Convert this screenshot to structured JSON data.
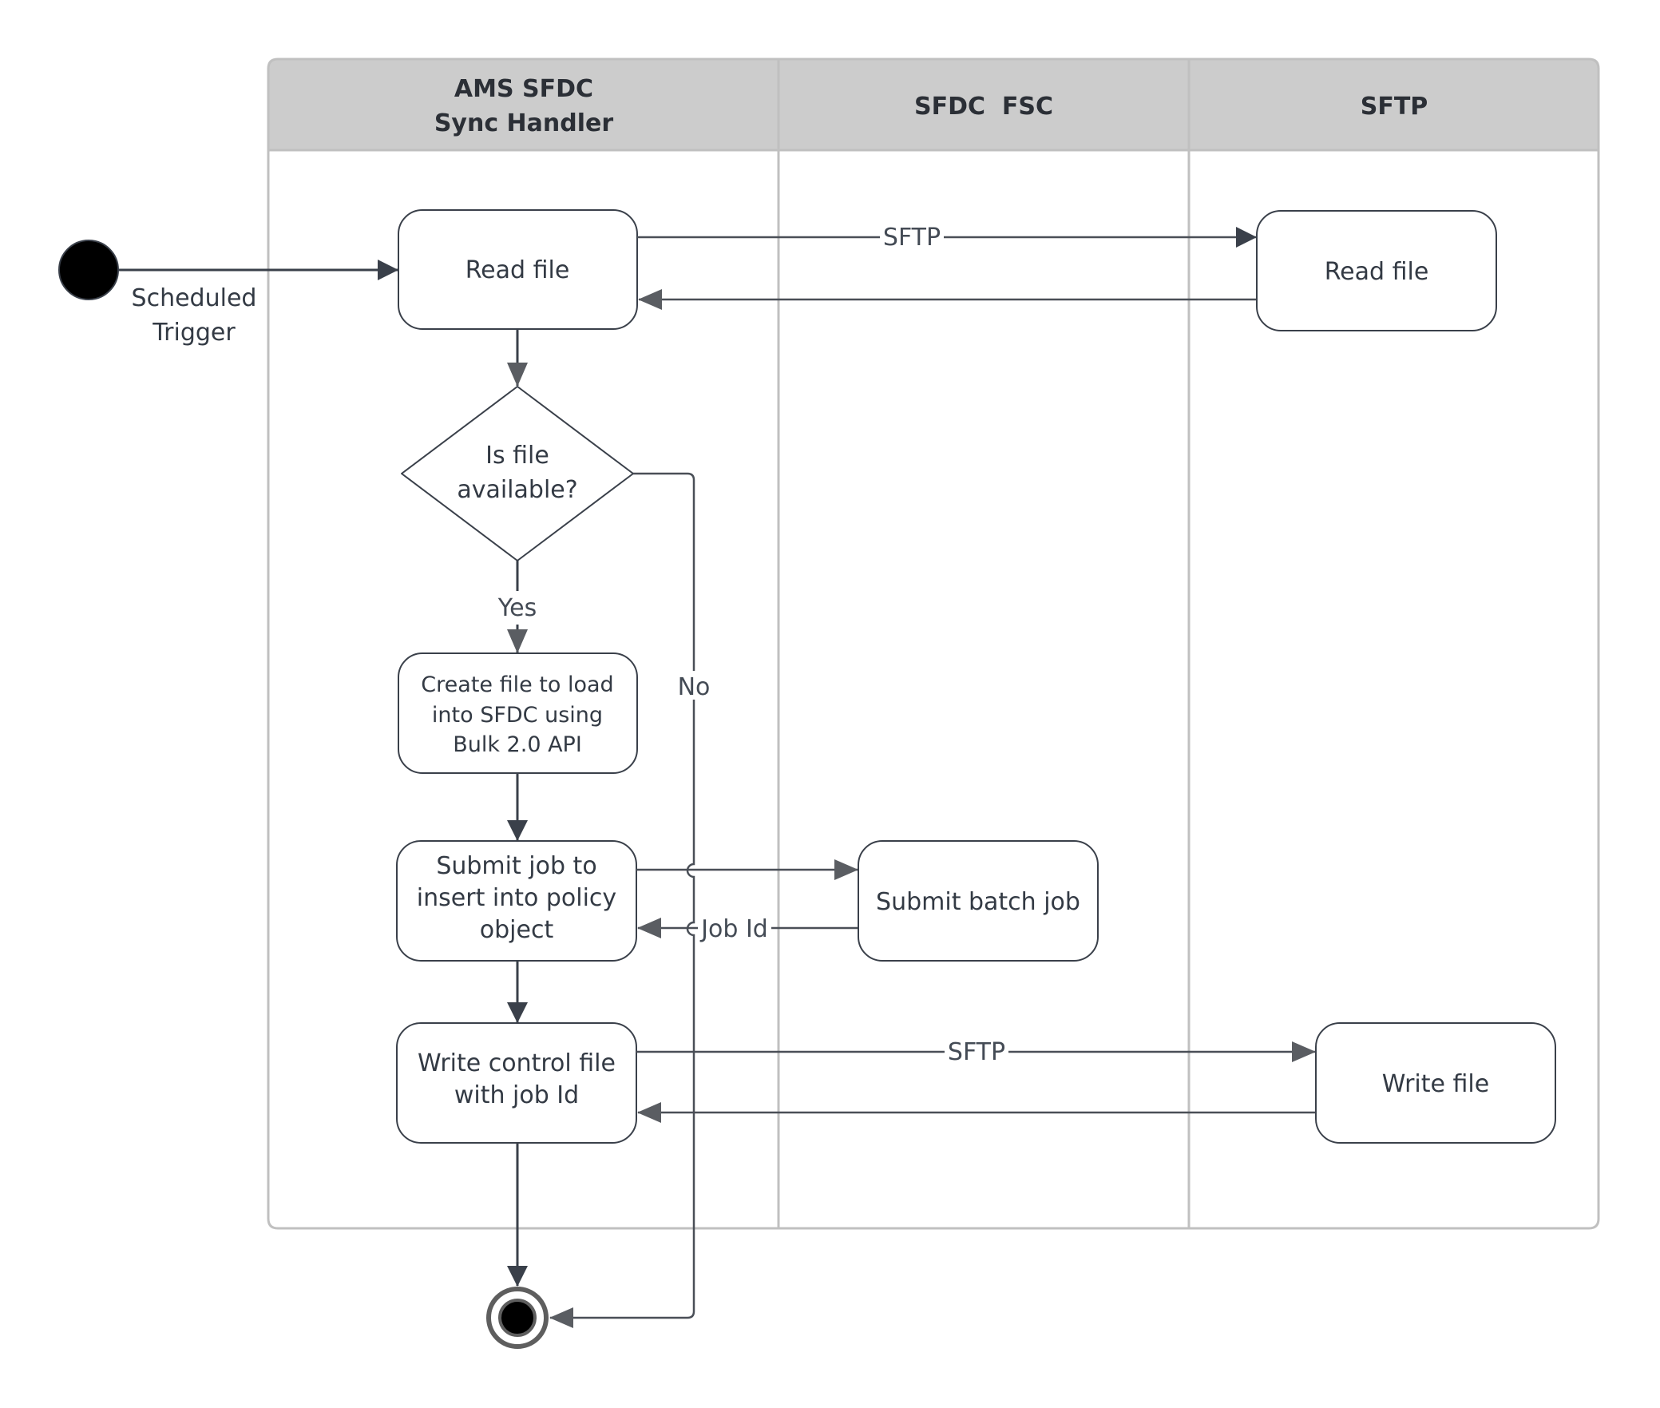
{
  "diagram": {
    "type": "UML activity diagram with swimlanes",
    "lanes": [
      {
        "id": "ams",
        "title_line1": "AMS SFDC",
        "title_line2": "Sync Handler"
      },
      {
        "id": "fsc",
        "title": "SFDC  FSC"
      },
      {
        "id": "sftp",
        "title": "SFTP"
      }
    ],
    "start": {
      "label_line1": "Scheduled",
      "label_line2": "Trigger"
    },
    "nodes": {
      "read_file": {
        "lane": "ams",
        "text": "Read file"
      },
      "sftp_read_file": {
        "lane": "sftp",
        "text": "Read file"
      },
      "decision": {
        "lane": "ams",
        "line1": "Is file",
        "line2": "available?"
      },
      "create_file": {
        "lane": "ams",
        "line1": "Create file to load",
        "line2": "into SFDC using",
        "line3": "Bulk 2.0 API"
      },
      "submit_job": {
        "lane": "ams",
        "line1": "Submit job to",
        "line2": "insert into policy",
        "line3": "object"
      },
      "submit_batch": {
        "lane": "fsc",
        "text": "Submit batch job"
      },
      "write_control": {
        "lane": "ams",
        "line1": "Write control file",
        "line2": "with job Id"
      },
      "write_file": {
        "lane": "sftp",
        "text": "Write file"
      }
    },
    "edge_labels": {
      "read_sftp": "SFTP",
      "yes": "Yes",
      "no": "No",
      "job_id": "Job Id",
      "write_sftp": "SFTP"
    },
    "colors": {
      "header_fill": "#cccccc",
      "lane_border": "#c0c0c0",
      "node_stroke": "#3a404a",
      "edge_stroke": "#4a4f57",
      "start_fill": "#000000"
    }
  }
}
